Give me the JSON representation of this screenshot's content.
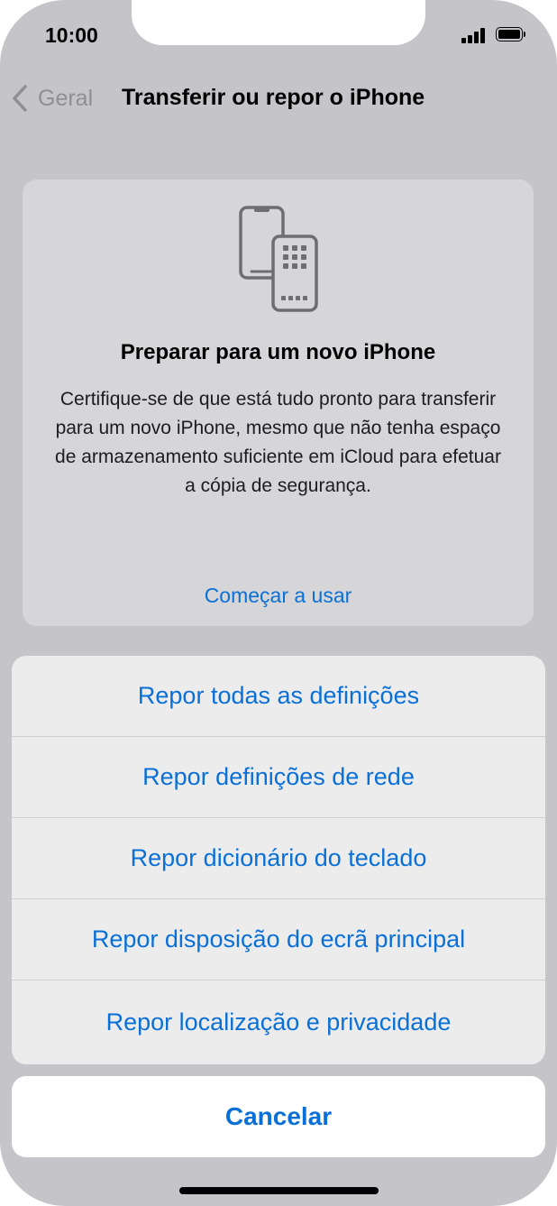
{
  "status_bar": {
    "time": "10:00",
    "icons": [
      "cellular-signal-icon",
      "battery-icon"
    ]
  },
  "nav": {
    "back_label": "Geral",
    "back_icon": "chevron-left-icon",
    "title": "Transferir ou repor o iPhone"
  },
  "card": {
    "icon": "two-phones-transfer-icon",
    "title": "Preparar para um novo iPhone",
    "description": "Certifique-se de que está tudo pronto para transferir para um novo iPhone, mesmo que não tenha espaço de armazenamento suficiente em iCloud para efetuar a cópia de segurança.",
    "link": "Começar a usar"
  },
  "action_sheet": {
    "items": [
      {
        "label": "Repor todas as definições"
      },
      {
        "label": "Repor definições de rede"
      },
      {
        "label": "Repor dicionário do teclado"
      },
      {
        "label": "Repor disposição do ecrã principal"
      },
      {
        "label": "Repor localização e privacidade"
      }
    ],
    "cancel_label": "Cancelar"
  },
  "colors": {
    "accent": "#0a70d8",
    "dim_background": "#c5c5c9",
    "card_background": "#d6d6d9",
    "sheet_background": "#ececed"
  }
}
